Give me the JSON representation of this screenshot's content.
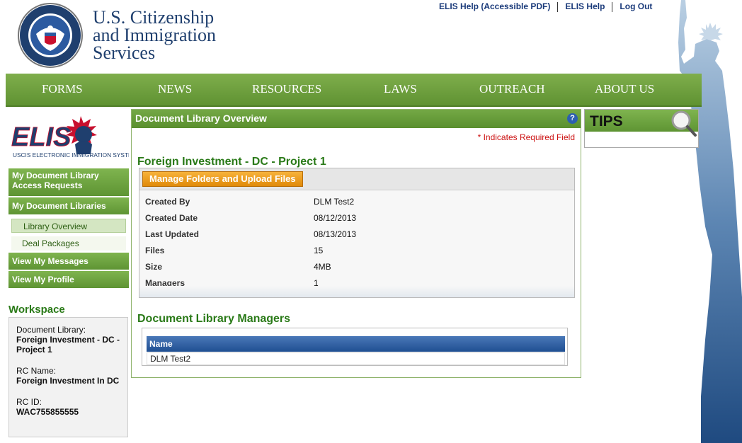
{
  "header": {
    "agency_line1": "U.S. Citizenship",
    "agency_line2": "and Immigration",
    "agency_line3": "Services",
    "seal_text": "U.S. DEPARTMENT OF HOMELAND SECURITY",
    "util_links": [
      "ELIS Help (Accessible PDF)",
      "ELIS Help",
      "Log Out"
    ]
  },
  "nav": [
    "FORMS",
    "NEWS",
    "RESOURCES",
    "LAWS",
    "OUTREACH",
    "ABOUT US"
  ],
  "elis_logo": {
    "name": "ELIS",
    "tagline": "USCIS ELECTRONIC IMMIGRATION SYSTEM"
  },
  "left_nav": {
    "access_requests": "My Document Library Access Requests",
    "libraries": "My Document Libraries",
    "library_overview": "Library Overview",
    "deal_packages": "Deal Packages",
    "messages": "View My Messages",
    "profile": "View My Profile"
  },
  "workspace": {
    "title": "Workspace",
    "library_label": "Document Library:",
    "library_value": "Foreign Investment - DC - Project 1",
    "rc_name_label": "RC Name:",
    "rc_name_value": "Foreign Investment In DC",
    "rc_id_label": "RC ID:",
    "rc_id_value": "WAC755855555"
  },
  "main": {
    "header": "Document Library Overview",
    "help": "?",
    "required_note": "* Indicates Required Field",
    "library_title": "Foreign Investment - DC - Project 1",
    "manage_button": "Manage Folders and Upload Files",
    "details": [
      {
        "label": "Created By",
        "value": "DLM Test2"
      },
      {
        "label": "Created Date",
        "value": "08/12/2013"
      },
      {
        "label": "Last Updated",
        "value": "08/13/2013"
      },
      {
        "label": "Files",
        "value": "15"
      },
      {
        "label": "Size",
        "value": "4MB"
      },
      {
        "label": "Managers",
        "value": "1"
      }
    ],
    "managers_title": "Document Library Managers",
    "managers_column": "Name",
    "managers_rows": [
      "DLM Test2"
    ]
  },
  "tips": {
    "label": "TIPS"
  },
  "colors": {
    "nav_green": "#6a9c3a",
    "heading_green": "#2a7a18",
    "link_blue": "#1a3a7a",
    "required_red": "#cc1111",
    "button_orange": "#e99a1c",
    "table_header_blue": "#2a5a9e"
  }
}
